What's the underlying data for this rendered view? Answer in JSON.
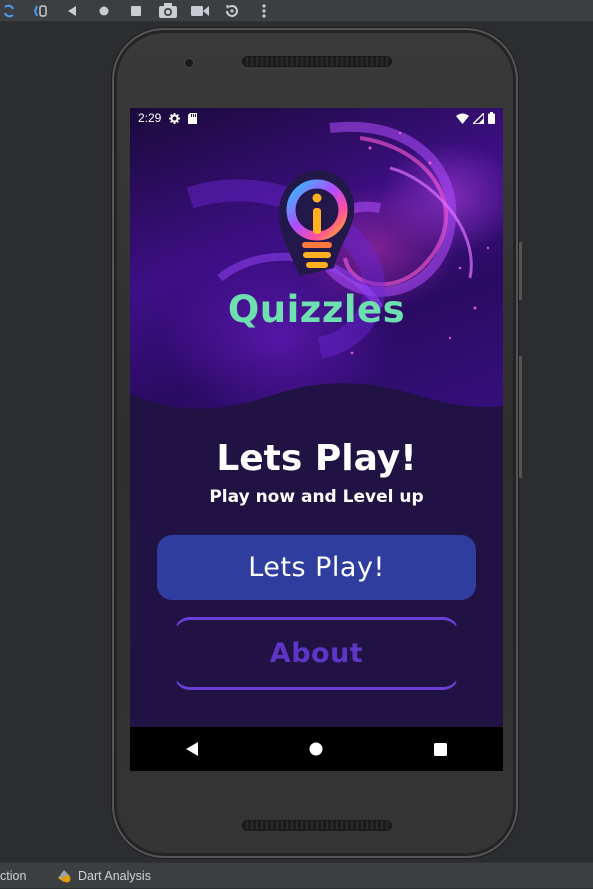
{
  "ide": {
    "toolbar_icons": [
      "sync-icon",
      "sync-alt-icon",
      "back-triangle-icon",
      "home-circle-icon",
      "stop-square-icon",
      "camera-icon",
      "video-icon",
      "rotate-icon",
      "more-vert-icon"
    ],
    "bottom_tabs": [
      {
        "label": "ction",
        "icon": ""
      },
      {
        "label": "Dart Analysis",
        "icon": "dart-analysis-icon"
      }
    ]
  },
  "status_bar": {
    "time": "2:29",
    "icons_left": [
      "settings-icon",
      "sd-card-icon"
    ],
    "icons_right": [
      "wifi-icon",
      "signal-icon",
      "battery-icon"
    ]
  },
  "app": {
    "brand": "Quizzles",
    "headline": "Lets Play!",
    "subline": "Play now and Level up",
    "primary_button": "Lets Play!",
    "secondary_button": "About"
  },
  "colors": {
    "brand_text": "#6ee0b0",
    "primary_button": "#2f3d9e",
    "outline_button": "#6c3fd8",
    "background": "#201343"
  },
  "nav_bar": [
    "back-icon",
    "home-icon",
    "recents-icon"
  ]
}
